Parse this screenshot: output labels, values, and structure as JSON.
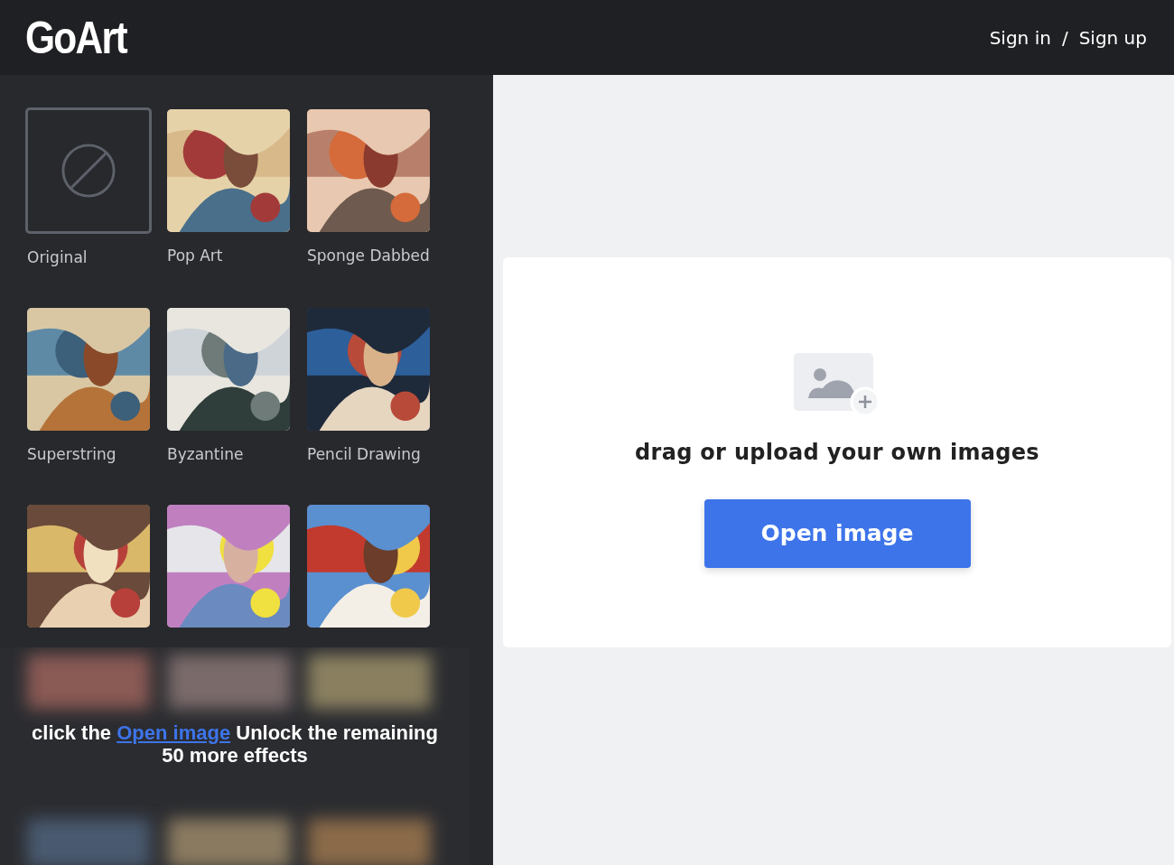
{
  "header": {
    "logo": "GoArt",
    "auth": {
      "sign_in": "Sign in",
      "separator": "/",
      "sign_up": "Sign up"
    }
  },
  "effects": [
    {
      "label": "Original",
      "kind": "none",
      "selected": true
    },
    {
      "label": "Pop Art",
      "kind": "picture",
      "selected": false
    },
    {
      "label": "Sponge Dabbed",
      "kind": "picture",
      "selected": false
    },
    {
      "label": "Superstring",
      "kind": "picture",
      "selected": false
    },
    {
      "label": "Byzantine",
      "kind": "picture",
      "selected": false
    },
    {
      "label": "Pencil Drawing",
      "kind": "picture",
      "selected": false
    },
    {
      "kind": "picture",
      "selected": false
    },
    {
      "kind": "picture",
      "selected": false
    },
    {
      "kind": "picture",
      "selected": false
    }
  ],
  "locked_overlay": {
    "kind": "picture",
    "before": "click the ",
    "link": "Open image",
    "after": " Unlock the remaining 50 more effects"
  },
  "upload": {
    "message": "drag or upload your own images",
    "button": "Open image"
  }
}
